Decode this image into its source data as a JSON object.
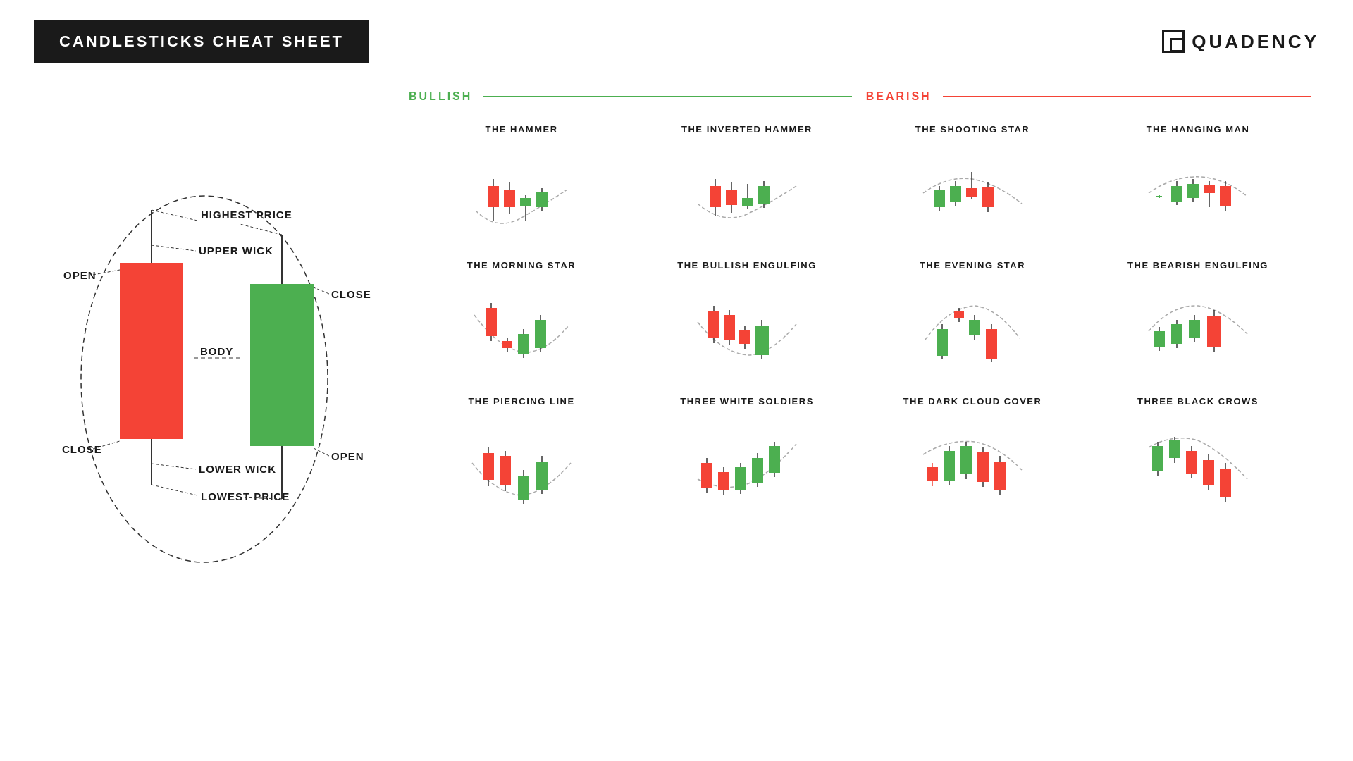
{
  "header": {
    "title": "CANDLESTICKS CHEAT SHEET",
    "logo_text": "QUADENCY"
  },
  "diagram": {
    "labels": {
      "highest_price": "HIGHEST PRICE",
      "upper_wick": "UPPER WICK",
      "open_left": "OPEN",
      "close_right": "CLOSE",
      "body": "BODY",
      "close_left": "CLOSE",
      "open_right": "OPEN",
      "lower_wick": "LOWER WICK",
      "lowest_price": "LOWEST PRICE"
    }
  },
  "categories": {
    "bullish": "BULLISH",
    "bearish": "BEARISH"
  },
  "patterns": [
    {
      "id": "hammer",
      "title": "THE HAMMER",
      "type": "bullish"
    },
    {
      "id": "inverted-hammer",
      "title": "THE INVERTED HAMMER",
      "type": "bullish"
    },
    {
      "id": "shooting-star",
      "title": "THE SHOOTING STAR",
      "type": "bearish"
    },
    {
      "id": "hanging-man",
      "title": "THE HANGING MAN",
      "type": "bearish"
    },
    {
      "id": "morning-star",
      "title": "THE MORNING STAR",
      "type": "bullish"
    },
    {
      "id": "bullish-engulfing",
      "title": "THE BULLISH ENGULFING",
      "type": "bullish"
    },
    {
      "id": "evening-star",
      "title": "THE EVENING STAR",
      "type": "bearish"
    },
    {
      "id": "bearish-engulfing",
      "title": "THE BEARISH ENGULFING",
      "type": "bearish"
    },
    {
      "id": "piercing-line",
      "title": "THE PIERCING LINE",
      "type": "bullish"
    },
    {
      "id": "three-white-soldiers",
      "title": "THREE WHITE SOLDIERS",
      "type": "bullish"
    },
    {
      "id": "dark-cloud-cover",
      "title": "THE DARK CLOUD COVER",
      "type": "bearish"
    },
    {
      "id": "three-black-crows",
      "title": "THREE BLACK CROWS",
      "type": "bearish"
    }
  ]
}
